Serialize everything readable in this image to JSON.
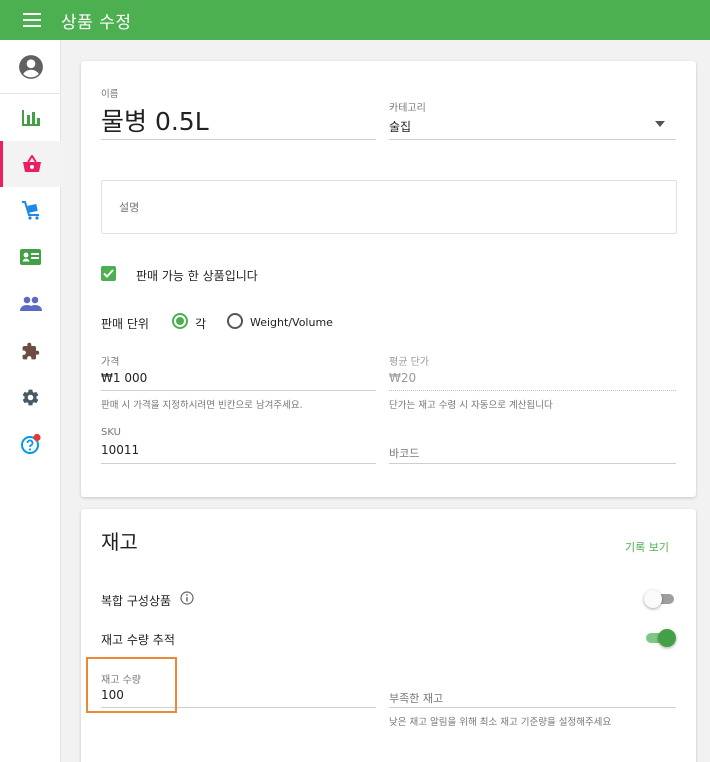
{
  "topbar": {
    "title": "상품 수정"
  },
  "sidebar": {
    "items": [
      {
        "icon": "account-circle-icon",
        "color": "#555555"
      },
      {
        "icon": "bar-chart-icon",
        "color": "#43a047"
      },
      {
        "icon": "basket-icon",
        "color": "#e91e63",
        "active": true
      },
      {
        "icon": "cart-icon",
        "color": "#1e88e5"
      },
      {
        "icon": "id-card-icon",
        "color": "#43a047"
      },
      {
        "icon": "people-icon",
        "color": "#5c6bc0"
      },
      {
        "icon": "puzzle-icon",
        "color": "#6d4c41"
      },
      {
        "icon": "gear-icon",
        "color": "#455a64"
      },
      {
        "icon": "help-icon",
        "color": "#039be5",
        "badge_color": "#e53935"
      }
    ]
  },
  "product": {
    "name_label": "이름",
    "name_value": "물병 0.5L",
    "category_label": "카테고리",
    "category_value": "술집",
    "description_placeholder": "설명",
    "available_label": "판매 가능 한 상품입니다",
    "sale_unit_label": "판매 단위",
    "unit_each": "각",
    "unit_weight": "Weight/Volume",
    "price_label": "가격",
    "price_value": "₩1 000",
    "price_hint": "판매 시 가격을 지정하시려면 빈칸으로 남겨주세요.",
    "avg_cost_label": "평균 단가",
    "avg_cost_value": "₩20",
    "avg_cost_hint": "단가는 재고 수령 시 자동으로 계산됩니다",
    "sku_label": "SKU",
    "sku_value": "10011",
    "barcode_placeholder": "바코드"
  },
  "inventory": {
    "title": "재고",
    "history_link": "기록 보기",
    "composite_label": "복합 구성상품",
    "composite_on": false,
    "track_label": "재고 수량 추적",
    "track_on": true,
    "stock_label": "재고 수량",
    "stock_value": "100",
    "low_stock_placeholder": "부족한 재고",
    "low_stock_hint": "낮은 재고 알림을 위해 최소 재고 기준량을 설정해주세요"
  },
  "colors": {
    "primary": "#4caf50",
    "accent": "#e91e63",
    "highlight": "#ed8936"
  }
}
